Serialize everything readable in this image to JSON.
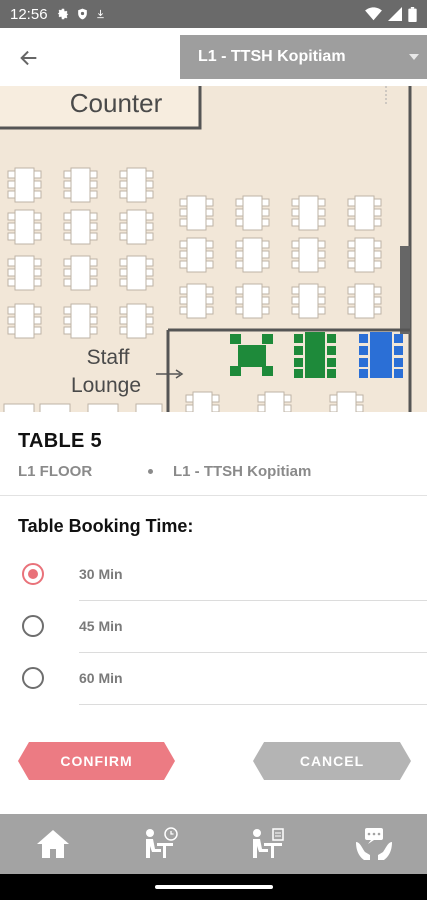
{
  "status_bar": {
    "time": "12:56",
    "left_icons": [
      "gear-icon",
      "shield-icon",
      "download-icon"
    ],
    "right_icons": [
      "wifi-icon",
      "signal-icon",
      "battery-icon"
    ]
  },
  "app_bar": {
    "back_icon": "arrow-left-icon",
    "location": "L1 - TTSH Kopitiam"
  },
  "floor_map": {
    "counter_label": "Counter",
    "staff_label_line1": "Staff",
    "staff_label_line2": "Lounge",
    "colors": {
      "background": "#f2e7d8",
      "available_table": "#ffffff",
      "table_green": "#1e8a3a",
      "table_blue": "#2b6fd6"
    }
  },
  "table": {
    "title": "TABLE 5",
    "floor": "L1 FLOOR",
    "location": "L1 - TTSH Kopitiam"
  },
  "booking": {
    "heading": "Table Booking Time:",
    "options": [
      {
        "label": "30 Min",
        "selected": true
      },
      {
        "label": "45 Min",
        "selected": false
      },
      {
        "label": "60 Min",
        "selected": false
      }
    ]
  },
  "actions": {
    "confirm": "CONFIRM",
    "cancel": "CANCEL",
    "confirm_color": "#ec7b83",
    "cancel_color": "#b4b4b4"
  },
  "bottom_nav": {
    "items": [
      "home-icon",
      "dining-time-icon",
      "dining-reserve-icon",
      "support-hands-icon"
    ]
  }
}
